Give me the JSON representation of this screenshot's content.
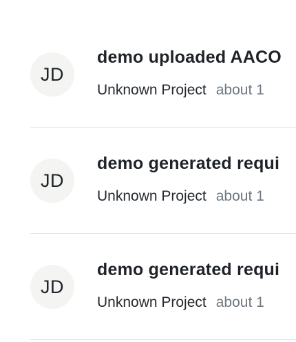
{
  "activity": {
    "items": [
      {
        "avatar": "JD",
        "title": "demo uploaded AACO",
        "project": "Unknown Project",
        "time": "about 1"
      },
      {
        "avatar": "JD",
        "title": "demo generated requi",
        "project": "Unknown Project",
        "time": "about 1"
      },
      {
        "avatar": "JD",
        "title": "demo generated requi",
        "project": "Unknown Project",
        "time": "about 1"
      }
    ]
  }
}
